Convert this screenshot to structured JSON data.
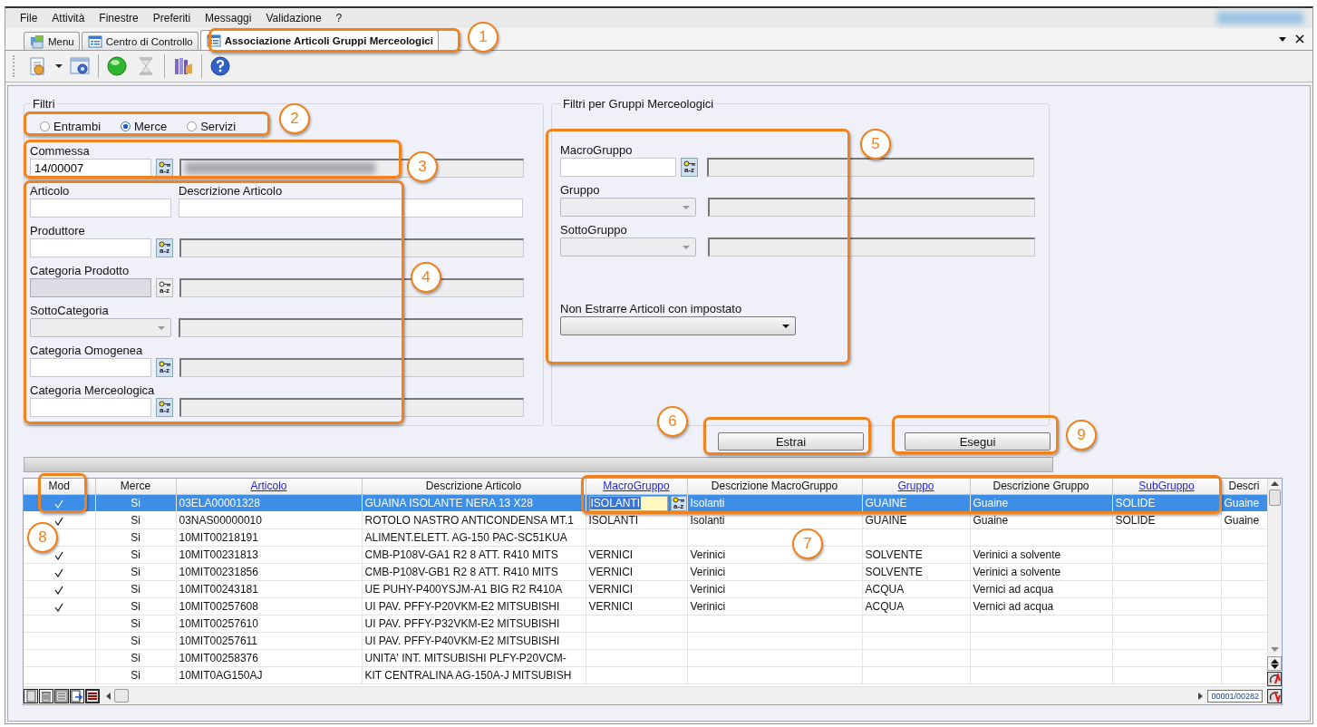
{
  "menu": [
    {
      "label": "File"
    },
    {
      "label": "Attività"
    },
    {
      "label": "Finestre"
    },
    {
      "label": "Preferiti"
    },
    {
      "label": "Messaggi"
    },
    {
      "label": "Validazione"
    },
    {
      "label": "?"
    }
  ],
  "tabs": [
    {
      "label": "Menu",
      "selected": false,
      "kind": "menu"
    },
    {
      "label": "Centro di Controllo",
      "selected": false,
      "kind": "form"
    },
    {
      "label": "Associazione Articoli Gruppi Merceologici",
      "selected": true,
      "kind": "form"
    }
  ],
  "toolbar": [
    {
      "kind": "wizard",
      "disabled": false
    },
    {
      "kind": "dropdown",
      "disabled": false
    },
    {
      "kind": "settings",
      "disabled": false
    },
    {
      "kind": "separator"
    },
    {
      "kind": "go",
      "disabled": false
    },
    {
      "kind": "hourglass",
      "disabled": true
    },
    {
      "kind": "separator"
    },
    {
      "kind": "library",
      "disabled": false
    },
    {
      "kind": "separator"
    },
    {
      "kind": "help",
      "disabled": false
    }
  ],
  "filters": {
    "title": "Filtri",
    "radios": [
      {
        "label": "Entrambi",
        "selected": false
      },
      {
        "label": "Merce",
        "selected": true
      },
      {
        "label": "Servizi",
        "selected": false
      }
    ],
    "fields": [
      {
        "kind": "lookup",
        "label": "Commessa",
        "value": "14/00007",
        "lookup": "a-z",
        "disabled": false,
        "redacted": true
      },
      {
        "kind": "pair",
        "label": "Articolo",
        "label2": "Descrizione Articolo"
      },
      {
        "kind": "lookup",
        "label": "Produttore",
        "lookup": "a-z",
        "disabled": false,
        "redacted": false
      },
      {
        "kind": "lookup",
        "label": "Categoria Prodotto",
        "lookup": "a-z",
        "disabled": true,
        "redacted": false
      },
      {
        "kind": "combo",
        "label": "SottoCategoria",
        "disabled": true
      },
      {
        "kind": "lookup",
        "label": "Categoria Omogenea",
        "lookup": "a-z",
        "disabled": false,
        "redacted": false
      },
      {
        "kind": "lookup",
        "label": "Categoria Merceologica",
        "lookup": "a-z",
        "disabled": false,
        "redacted": false
      }
    ]
  },
  "group_filters": {
    "title": "Filtri per Gruppi Merceologici",
    "fields": [
      {
        "kind": "lookup",
        "label": "MacroGruppo",
        "lookup": "a-z",
        "disabled": false,
        "redacted": false
      },
      {
        "kind": "combo",
        "label": "Gruppo",
        "disabled": true
      },
      {
        "kind": "combo",
        "label": "SottoGruppo",
        "disabled": true
      },
      {
        "kind": "select",
        "label": "Non Estrarre Articoli con impostato",
        "disabled": false
      }
    ]
  },
  "buttons": [
    {
      "label": "Estrai"
    },
    {
      "label": "Esegui"
    }
  ],
  "table": {
    "columns": [
      {
        "label": "Mod",
        "sortable": false
      },
      {
        "label": "Merce",
        "sortable": false
      },
      {
        "label": "Articolo",
        "sortable": true
      },
      {
        "label": "Descrizione  Articolo",
        "sortable": false
      },
      {
        "label": "MacroGruppo",
        "sortable": true
      },
      {
        "label": "Descrizione  MacroGruppo",
        "sortable": false
      },
      {
        "label": "Gruppo",
        "sortable": true
      },
      {
        "label": "Descrizione  Gruppo",
        "sortable": false
      },
      {
        "label": "SubGruppo",
        "sortable": true
      },
      {
        "label": "Descri",
        "sortable": false
      }
    ],
    "rows": [
      {
        "selected": true,
        "modified": true,
        "editing": true,
        "lookup": "a-z",
        "cells": [
          null,
          "Si",
          "03ELA00001328",
          "GUAINA ISOLANTE NERA 13 X28",
          "ISOLANTI",
          "Isolanti",
          "GUAINE",
          "Guaine",
          "SOLIDE",
          "Guaine"
        ]
      },
      {
        "selected": false,
        "modified": true,
        "editing": false,
        "cells": [
          null,
          "Si",
          "03NAS00000010",
          "ROTOLO NASTRO ANTICONDENSA MT.1",
          "ISOLANTI",
          "Isolanti",
          "GUAINE",
          "Guaine",
          "SOLIDE",
          "Guaine"
        ]
      },
      {
        "selected": false,
        "modified": false,
        "editing": false,
        "cells": [
          null,
          "Si",
          "10MIT00218191",
          "ALIMENT.ELETT. AG-150 PAC-SC51KUA",
          null,
          null,
          null,
          null,
          null,
          null
        ]
      },
      {
        "selected": false,
        "modified": true,
        "editing": false,
        "cells": [
          null,
          "Si",
          "10MIT00231813",
          "CMB-P108V-GA1 R2 8 ATT. R410 MITS",
          "VERNICI",
          "Verinici",
          "SOLVENTE",
          "Verinici a solvente",
          null,
          null
        ]
      },
      {
        "selected": false,
        "modified": true,
        "editing": false,
        "cells": [
          null,
          "Si",
          "10MIT00231856",
          "CMB-P108V-GB1 R2 8 ATT. R410 MITS",
          "VERNICI",
          "Verinici",
          "SOLVENTE",
          "Verinici a solvente",
          null,
          null
        ]
      },
      {
        "selected": false,
        "modified": true,
        "editing": false,
        "cells": [
          null,
          "Si",
          "10MIT00243181",
          "UE PUHY-P400YSJM-A1 BIG R2 R410A",
          "VERNICI",
          "Verinici",
          "ACQUA",
          "Vernici ad acqua",
          null,
          null
        ]
      },
      {
        "selected": false,
        "modified": true,
        "editing": false,
        "cells": [
          null,
          "Si",
          "10MIT00257608",
          "UI PAV. PFFY-P20VKM-E2 MITSUBISHI",
          "VERNICI",
          "Verinici",
          "ACQUA",
          "Vernici ad acqua",
          null,
          null
        ]
      },
      {
        "selected": false,
        "modified": false,
        "editing": false,
        "cells": [
          null,
          "Si",
          "10MIT00257610",
          "UI PAV. PFFY-P32VKM-E2 MITSUBISHI",
          null,
          null,
          null,
          null,
          null,
          null
        ]
      },
      {
        "selected": false,
        "modified": false,
        "editing": false,
        "cells": [
          null,
          "Si",
          "10MIT00257611",
          "UI PAV. PFFY-P40VKM-E2 MITSUBISHI",
          null,
          null,
          null,
          null,
          null,
          null
        ]
      },
      {
        "selected": false,
        "modified": false,
        "editing": false,
        "cells": [
          null,
          "Si",
          "10MIT00258376",
          "UNITA' INT. MITSUBISHI PLFY-P20VCM-",
          null,
          null,
          null,
          null,
          null,
          null
        ]
      },
      {
        "selected": false,
        "modified": false,
        "editing": false,
        "cells": [
          null,
          "Si",
          "10MIT0AG150AJ",
          "KIT CENTRALINA AG-150A-J MITSUBISH",
          null,
          null,
          null,
          null,
          null,
          null
        ]
      }
    ],
    "record_counter": "00001/00282"
  },
  "callouts": [
    {
      "number": "1"
    },
    {
      "number": "2"
    },
    {
      "number": "3"
    },
    {
      "number": "4"
    },
    {
      "number": "5"
    },
    {
      "number": "6"
    },
    {
      "number": "7"
    },
    {
      "number": "8"
    },
    {
      "number": "9"
    }
  ]
}
